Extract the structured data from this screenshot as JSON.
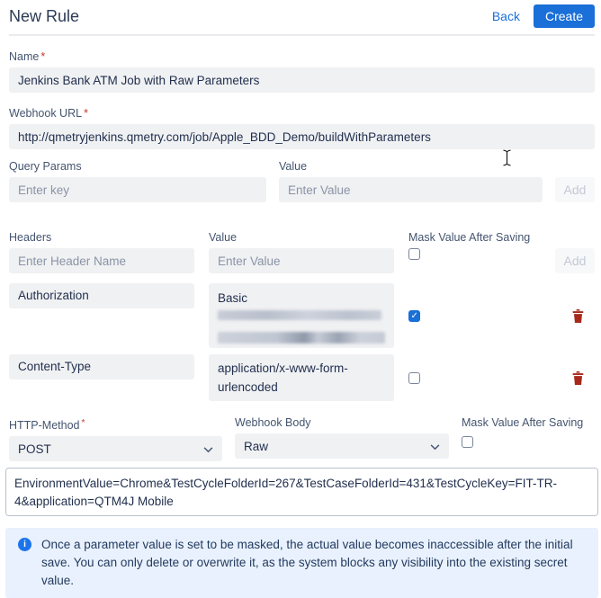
{
  "ui": {
    "required_mark": "*"
  },
  "header": {
    "title": "New Rule",
    "back_label": "Back",
    "create_label": "Create"
  },
  "name_field": {
    "label": "Name",
    "value": "Jenkins Bank ATM Job with Raw Parameters"
  },
  "url_field": {
    "label": "Webhook URL",
    "value": "http://qmetryjenkins.qmetry.com/job/Apple_BDD_Demo/buildWithParameters"
  },
  "query_params": {
    "label": "Query Params",
    "value_label": "Value",
    "key_placeholder": "Enter key",
    "value_placeholder": "Enter Value",
    "add_label": "Add"
  },
  "headers_section": {
    "label": "Headers",
    "value_label": "Value",
    "mask_label": "Mask Value After Saving",
    "key_placeholder": "Enter Header Name",
    "value_placeholder": "Enter Value",
    "add_label": "Add",
    "rows": [
      {
        "key": "Authorization",
        "value": "Basic",
        "masked": true
      },
      {
        "key": "Content-Type",
        "value": "application/x-www-form-urlencoded",
        "masked": false
      }
    ]
  },
  "method_field": {
    "label": "HTTP-Method",
    "value": "POST"
  },
  "body_type_field": {
    "label": "Webhook Body",
    "value": "Raw"
  },
  "mask_field": {
    "label": "Mask Value After Saving",
    "checked": false
  },
  "body_field": {
    "value": "EnvironmentValue=Chrome&TestCycleFolderId=267&TestCaseFolderId=431&TestCycleKey=FIT-TR-4&application=QTM4J Mobile"
  },
  "info_note": {
    "text": "Once a parameter value is set to be masked, the actual value becomes inaccessible after the initial save. You can only delete or overwrite it, as the system blocks any visibility into the existing secret value."
  },
  "colors": {
    "accent": "#1a6fd8",
    "danger": "#a7291b",
    "info_bg": "#e8f1fd",
    "info_icon": "#1d74ea",
    "input_bg": "#f0f1f3",
    "label": "#44546f",
    "text": "#22304e",
    "placeholder": "#8a94a6"
  }
}
